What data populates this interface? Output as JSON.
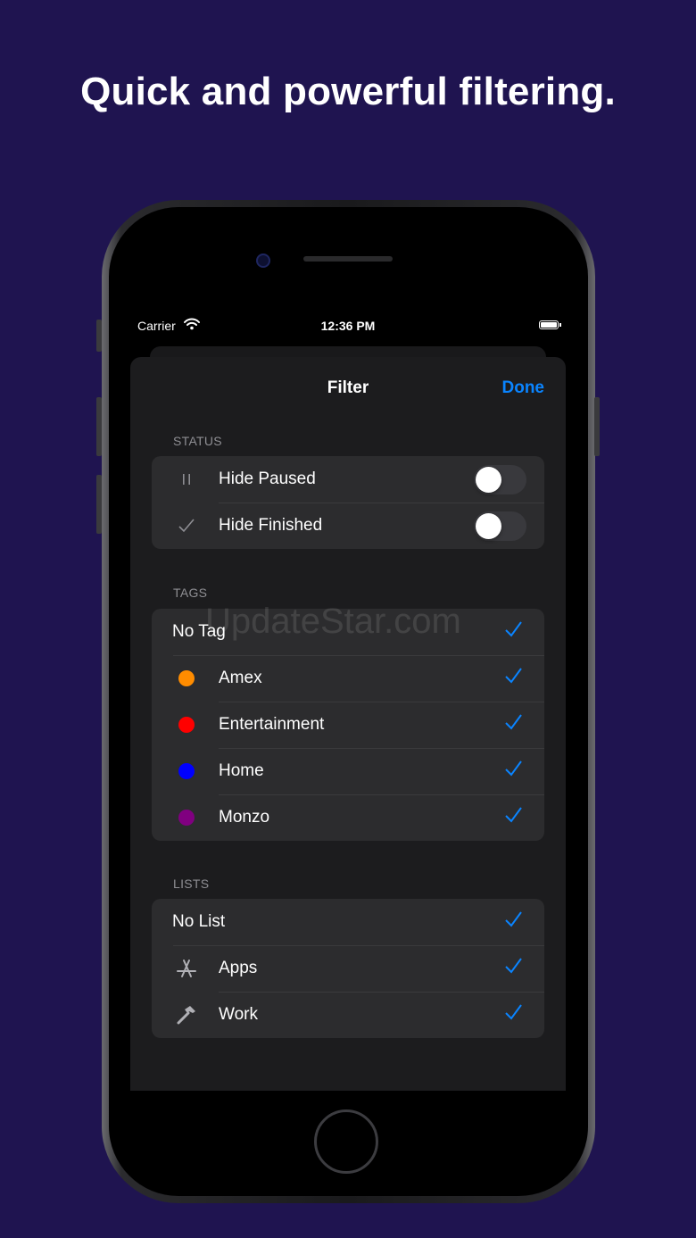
{
  "headline": "Quick and powerful filtering.",
  "status_bar": {
    "carrier": "Carrier",
    "time": "12:36 PM"
  },
  "nav": {
    "title": "Filter",
    "done_label": "Done"
  },
  "colors": {
    "background": "#1f1450",
    "accent": "#0a84ff",
    "sheet": "#1c1c1e",
    "row": "#2c2c2e"
  },
  "status": {
    "header": "STATUS",
    "rows": [
      {
        "label": "Hide Paused",
        "icon": "pause-icon",
        "enabled": false
      },
      {
        "label": "Hide Finished",
        "icon": "checkmark-icon",
        "enabled": false
      }
    ]
  },
  "tags": {
    "header": "TAGS",
    "rows": [
      {
        "label": "No Tag",
        "color": null,
        "checked": true
      },
      {
        "label": "Amex",
        "color": "#ff8c00",
        "checked": true
      },
      {
        "label": "Entertainment",
        "color": "#ff0000",
        "checked": true
      },
      {
        "label": "Home",
        "color": "#0000ff",
        "checked": true
      },
      {
        "label": "Monzo",
        "color": "#800080",
        "checked": true
      }
    ]
  },
  "lists": {
    "header": "LISTS",
    "rows": [
      {
        "label": "No List",
        "icon": null,
        "checked": true
      },
      {
        "label": "Apps",
        "icon": "app-store-icon",
        "checked": true
      },
      {
        "label": "Work",
        "icon": "hammer-icon",
        "checked": true
      }
    ]
  },
  "watermark": "UpdateStar.com"
}
